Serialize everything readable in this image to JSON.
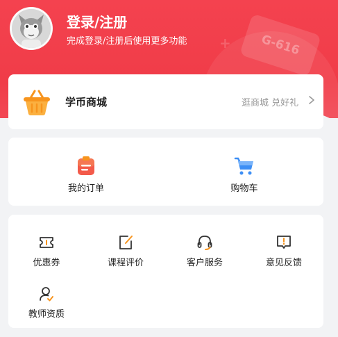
{
  "header": {
    "title": "登录/注册",
    "subtitle": "完成登录/注册后使用更多功能",
    "sign_text": "G-616"
  },
  "mall": {
    "title": "学币商城",
    "link_text": "逛商城 兑好礼"
  },
  "orders": [
    {
      "label": "我的订单",
      "icon": "order-icon"
    },
    {
      "label": "购物车",
      "icon": "cart-icon"
    }
  ],
  "services": [
    {
      "label": "优惠券",
      "icon": "coupon-icon"
    },
    {
      "label": "课程评价",
      "icon": "edit-icon"
    },
    {
      "label": "客户服务",
      "icon": "headset-icon"
    },
    {
      "label": "意见反馈",
      "icon": "feedback-icon"
    },
    {
      "label": "教师资质",
      "icon": "teacher-icon"
    }
  ],
  "colors": {
    "brand_red": "#f03c48",
    "accent_orange": "#f7941d",
    "accent_blue": "#3c8ef5",
    "icon_dark": "#333333"
  }
}
